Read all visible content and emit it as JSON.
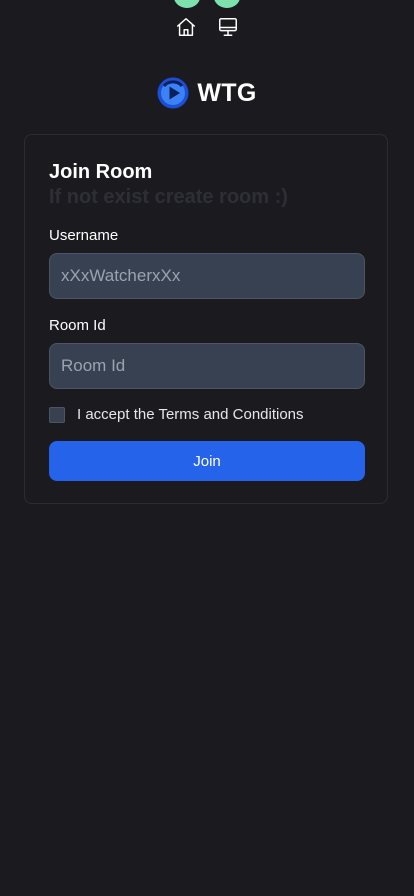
{
  "brand": {
    "name": "WTG",
    "logo_icon": "wtg-play-logo-icon"
  },
  "nav": {
    "items": [
      {
        "icon": "home-icon"
      },
      {
        "icon": "desktop-icon"
      }
    ]
  },
  "form": {
    "title": "Join Room",
    "subtitle": "If not exist create room :)",
    "username_label": "Username",
    "username_placeholder": "xXxWatcherxXx",
    "room_label": "Room Id",
    "room_placeholder": "Room Id",
    "terms_label": "I accept the Terms and Conditions",
    "submit_label": "Join"
  },
  "colors": {
    "background": "#1b1b1f",
    "accent": "#2563eb",
    "input_bg": "#374151",
    "decor_green": "#7ee0ad"
  }
}
